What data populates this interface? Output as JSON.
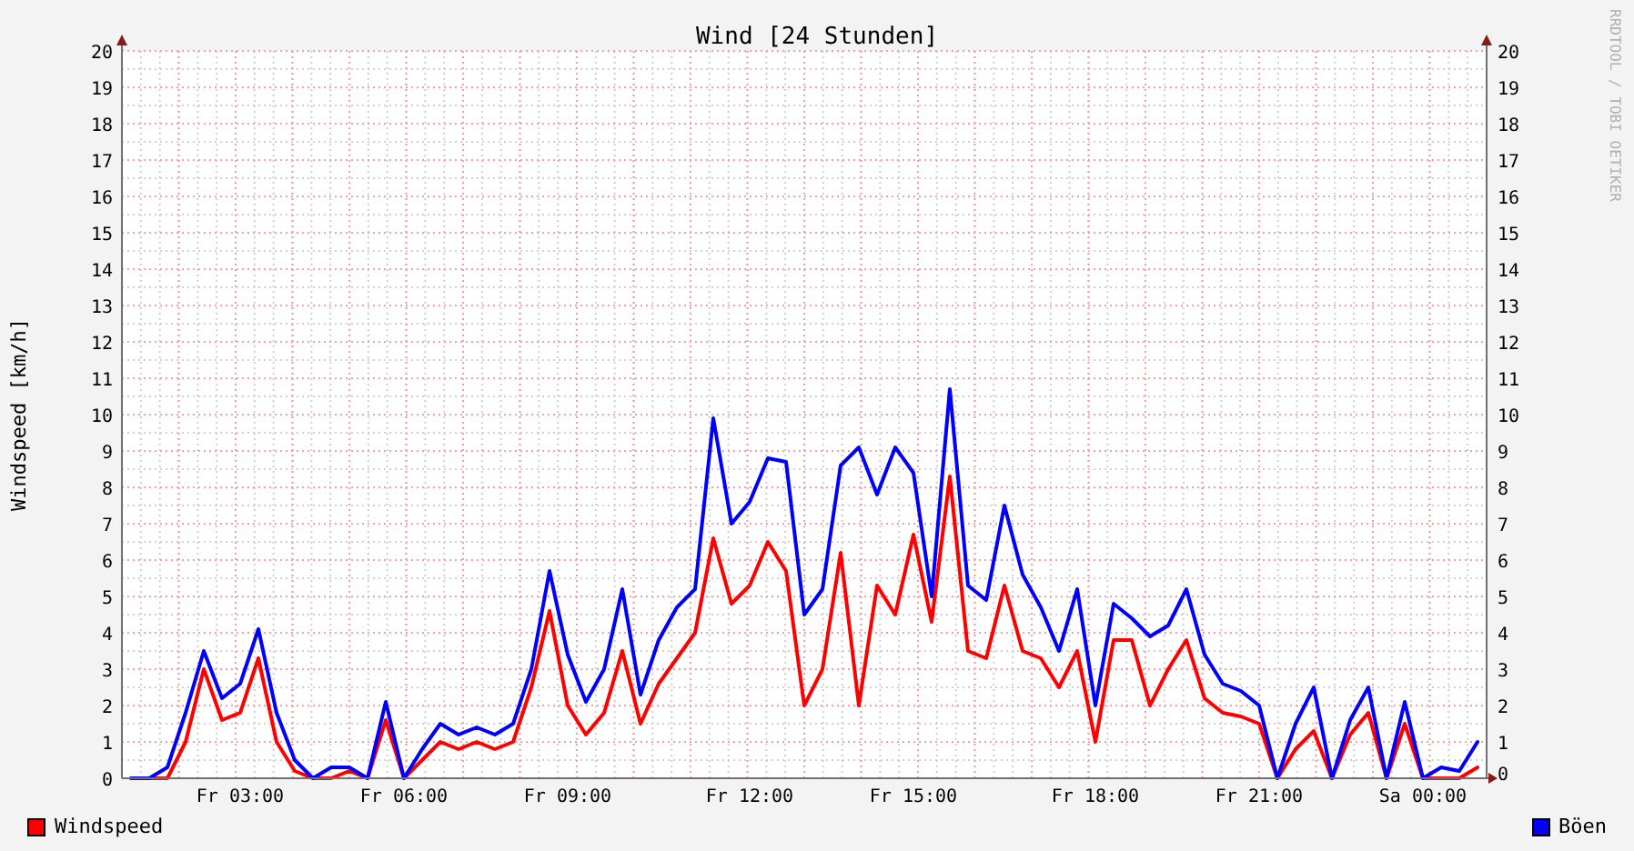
{
  "chart": {
    "right_axis_labels": [
      "20",
      "19",
      "18",
      "17",
      "16",
      "15",
      "14",
      "13",
      "12",
      "11",
      "10",
      "9",
      "8",
      "7",
      "6",
      "5",
      "4",
      "3",
      "2",
      "1",
      "0"
    ],
    "credit": "RRDTOOL / TOBI OETIKER",
    "chart_data": {
      "type": "line",
      "title": "Wind [24 Stunden]",
      "ylabel": "Windspeed [km/h]",
      "categories": [
        null,
        null,
        null,
        null,
        null,
        null,
        "Fr 03:00",
        null,
        null,
        null,
        null,
        null,
        null,
        null,
        null,
        "Fr 06:00",
        null,
        null,
        null,
        null,
        null,
        null,
        null,
        null,
        "Fr 09:00",
        null,
        null,
        null,
        null,
        null,
        null,
        null,
        null,
        null,
        "Fr 12:00",
        null,
        null,
        null,
        null,
        null,
        null,
        null,
        null,
        "Fr 15:00",
        null,
        null,
        null,
        null,
        null,
        null,
        null,
        null,
        null,
        "Fr 18:00",
        null,
        null,
        null,
        null,
        null,
        null,
        null,
        null,
        "Fr 21:00",
        null,
        null,
        null,
        null,
        null,
        null,
        null,
        null,
        "Sa 00:00",
        null,
        null,
        null
      ],
      "series": [
        {
          "name": "Windspeed",
          "color": "#ff0000",
          "values": [
            0,
            0,
            0,
            1.0,
            3.0,
            1.6,
            1.8,
            3.3,
            1.0,
            0.2,
            0,
            0,
            0.2,
            0,
            1.6,
            0,
            0.5,
            1.0,
            0.8,
            1.0,
            0.8,
            1.0,
            2.5,
            4.6,
            2.0,
            1.2,
            1.8,
            3.5,
            1.5,
            2.6,
            3.3,
            4.0,
            6.6,
            4.8,
            5.3,
            6.5,
            5.7,
            2.0,
            3.0,
            6.2,
            2.0,
            5.3,
            4.5,
            6.7,
            4.3,
            8.3,
            3.5,
            3.3,
            5.3,
            3.5,
            3.3,
            2.5,
            3.5,
            1.0,
            3.8,
            3.8,
            2.0,
            3.0,
            3.8,
            2.2,
            1.8,
            1.7,
            1.5,
            0,
            0.8,
            1.3,
            0,
            1.2,
            1.8,
            0,
            1.5,
            0,
            0,
            0,
            0.3
          ]
        },
        {
          "name": "Böen",
          "color": "#0000ff",
          "values": [
            0,
            0,
            0.3,
            1.8,
            3.5,
            2.2,
            2.6,
            4.1,
            1.8,
            0.5,
            0,
            0.3,
            0.3,
            0,
            2.1,
            0,
            0.8,
            1.5,
            1.2,
            1.4,
            1.2,
            1.5,
            3.0,
            5.7,
            3.4,
            2.1,
            3.0,
            5.2,
            2.3,
            3.8,
            4.7,
            5.2,
            9.9,
            7.0,
            7.6,
            8.8,
            8.7,
            4.5,
            5.2,
            8.6,
            9.1,
            7.8,
            9.1,
            8.4,
            5.0,
            10.7,
            5.3,
            4.9,
            7.5,
            5.6,
            4.7,
            3.5,
            5.2,
            2.0,
            4.8,
            4.4,
            3.9,
            4.2,
            5.2,
            3.4,
            2.6,
            2.4,
            2.0,
            0,
            1.5,
            2.5,
            0,
            1.6,
            2.5,
            0,
            2.1,
            0,
            0.3,
            0.2,
            1.0
          ]
        }
      ],
      "ylim": [
        0,
        20
      ],
      "grid": true,
      "yticks": [
        0,
        1,
        2,
        3,
        4,
        5,
        6,
        7,
        8,
        9,
        10,
        11,
        12,
        13,
        14,
        15,
        16,
        17,
        18,
        19,
        20
      ]
    }
  }
}
